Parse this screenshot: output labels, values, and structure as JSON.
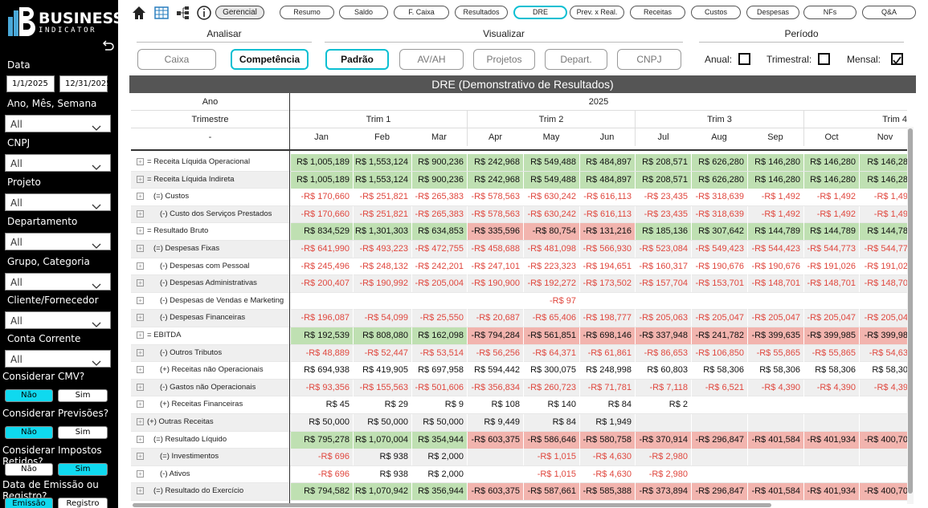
{
  "brand": {
    "line1": "BUSINESS",
    "line2": "INDICATOR"
  },
  "sidebar": {
    "date_label": "Data",
    "date_from": "1/1/2025",
    "date_to": "12/31/2025",
    "filters": [
      {
        "label": "Ano, Mês, Semana",
        "value": "All"
      },
      {
        "label": "CNPJ",
        "value": "All"
      },
      {
        "label": "Projeto",
        "value": "All"
      },
      {
        "label": "Departamento",
        "value": "All"
      },
      {
        "label": "Grupo, Categoria",
        "value": "All"
      },
      {
        "label": "Cliente/Fornecedor",
        "value": "All"
      },
      {
        "label": "Conta Corrente",
        "value": "All"
      }
    ],
    "toggles": [
      {
        "label": "Considerar CMV?",
        "a": "Não",
        "b": "Sim",
        "active": "a"
      },
      {
        "label": "Considerar Previsões?",
        "a": "Não",
        "b": "Sim",
        "active": "a"
      },
      {
        "label": "Considerar Impostos Retidos?",
        "a": "Não",
        "b": "Sim",
        "active": "b"
      },
      {
        "label": "Data de Emissão ou Registro?",
        "a": "Emissão",
        "b": "Registro",
        "active": "a"
      }
    ]
  },
  "topnav": {
    "gerencial": "Gerencial",
    "tabs": [
      "Resumo",
      "Saldo",
      "F. Caixa",
      "Resultados",
      "DRE",
      "Prev. x Real.",
      "Receitas",
      "Custos",
      "Despesas",
      "NFs",
      "Q&A"
    ],
    "selected": "DRE"
  },
  "sections": {
    "analisar": "Analisar",
    "visualizar": "Visualizar",
    "periodo": "Período"
  },
  "analisar_buttons": [
    "Caixa",
    "Competência"
  ],
  "visualizar_buttons": [
    "Padrão",
    "AV/AH",
    "Projetos",
    "Depart.",
    "CNPJ"
  ],
  "periodo": [
    {
      "label": "Anual:",
      "checked": false
    },
    {
      "label": "Trimestral:",
      "checked": false
    },
    {
      "label": "Mensal:",
      "checked": true
    }
  ],
  "report_title": "DRE (Demonstrativo de Resultados)",
  "table": {
    "hdr_ano": "Ano",
    "hdr_trimestre": "Trimestre",
    "hdr_dash": "-",
    "year": "2025",
    "quarters": [
      "Trim 1",
      "Trim 2",
      "Trim 3",
      "Trim 4"
    ],
    "months": [
      "Jan",
      "Feb",
      "Mar",
      "Apr",
      "May",
      "Jun",
      "Jul",
      "Aug",
      "Sep",
      "Oct",
      "Nov"
    ],
    "rows": [
      {
        "label": "= Receita Líquida Operacional",
        "indent": 0,
        "hl": true,
        "vals": [
          "R$ 1,005,189",
          "R$ 1,553,124",
          "R$ 900,236",
          "R$ 242,968",
          "R$ 549,488",
          "R$ 484,897",
          "R$ 208,571",
          "R$ 626,280",
          "R$ 146,280",
          "R$ 146,280",
          "R$ 146,28"
        ]
      },
      {
        "label": "= Receita Líquida Indireta",
        "indent": 0,
        "hl": true,
        "vals": [
          "R$ 1,005,189",
          "R$ 1,553,124",
          "R$ 900,236",
          "R$ 242,968",
          "R$ 549,488",
          "R$ 484,897",
          "R$ 208,571",
          "R$ 626,280",
          "R$ 146,280",
          "R$ 146,280",
          "R$ 146,28"
        ]
      },
      {
        "label": "(=) Custos",
        "indent": 1,
        "hl": false,
        "vals": [
          "-R$ 170,660",
          "-R$ 251,821",
          "-R$ 265,383",
          "-R$ 578,563",
          "-R$ 630,242",
          "-R$ 616,113",
          "-R$ 23,435",
          "-R$ 318,639",
          "-R$ 1,492",
          "-R$ 1,492",
          "-R$ 1,49"
        ]
      },
      {
        "label": "(-) Custo dos Serviços Prestados",
        "indent": 2,
        "hl": false,
        "vals": [
          "-R$ 170,660",
          "-R$ 251,821",
          "-R$ 265,383",
          "-R$ 578,563",
          "-R$ 630,242",
          "-R$ 616,113",
          "-R$ 23,435",
          "-R$ 318,639",
          "-R$ 1,492",
          "-R$ 1,492",
          "-R$ 1,49"
        ]
      },
      {
        "label": "= Resultado Bruto",
        "indent": 0,
        "hl": true,
        "vals": [
          "R$ 834,529",
          "R$ 1,301,303",
          "R$ 634,853",
          "-R$ 335,596",
          "-R$ 80,754",
          "-R$ 131,216",
          "R$ 185,136",
          "R$ 307,642",
          "R$ 144,789",
          "R$ 144,789",
          "R$ 144,78"
        ]
      },
      {
        "label": "(=) Despesas Fixas",
        "indent": 1,
        "hl": false,
        "vals": [
          "-R$ 641,990",
          "-R$ 493,223",
          "-R$ 472,755",
          "-R$ 458,688",
          "-R$ 481,098",
          "-R$ 566,930",
          "-R$ 523,084",
          "-R$ 549,423",
          "-R$ 544,423",
          "-R$ 544,773",
          "-R$ 544,77"
        ]
      },
      {
        "label": "(-) Despesas com Pessoal",
        "indent": 2,
        "hl": false,
        "vals": [
          "-R$ 245,496",
          "-R$ 248,132",
          "-R$ 242,201",
          "-R$ 247,101",
          "-R$ 223,323",
          "-R$ 194,651",
          "-R$ 160,317",
          "-R$ 190,676",
          "-R$ 190,676",
          "-R$ 191,026",
          "-R$ 191,02"
        ]
      },
      {
        "label": "(-) Despesas Administrativas",
        "indent": 2,
        "hl": false,
        "vals": [
          "-R$ 200,407",
          "-R$ 190,992",
          "-R$ 205,004",
          "-R$ 190,900",
          "-R$ 192,272",
          "-R$ 173,502",
          "-R$ 157,704",
          "-R$ 153,701",
          "-R$ 148,701",
          "-R$ 148,701",
          "-R$ 148,70"
        ]
      },
      {
        "label": "(-) Despesas de Vendas e Marketing",
        "indent": 2,
        "hl": false,
        "vals": [
          "",
          "",
          "",
          "",
          "-R$ 97",
          "",
          "",
          "",
          "",
          "",
          ""
        ]
      },
      {
        "label": "(-) Despesas Financeiras",
        "indent": 2,
        "hl": false,
        "vals": [
          "-R$ 196,087",
          "-R$ 54,099",
          "-R$ 25,550",
          "-R$ 20,687",
          "-R$ 65,406",
          "-R$ 198,777",
          "-R$ 205,063",
          "-R$ 205,047",
          "-R$ 205,047",
          "-R$ 205,047",
          "-R$ 205,04"
        ]
      },
      {
        "label": "= EBITDA",
        "indent": 0,
        "hl": true,
        "vals": [
          "R$ 192,539",
          "R$ 808,080",
          "R$ 162,098",
          "-R$ 794,284",
          "-R$ 561,851",
          "-R$ 698,146",
          "-R$ 337,948",
          "-R$ 241,782",
          "-R$ 399,635",
          "-R$ 399,985",
          "-R$ 399,98"
        ]
      },
      {
        "label": "(-) Outros Tributos",
        "indent": 2,
        "hl": false,
        "vals": [
          "-R$ 48,889",
          "-R$ 52,447",
          "-R$ 53,514",
          "-R$ 56,256",
          "-R$ 64,371",
          "-R$ 61,861",
          "-R$ 86,653",
          "-R$ 106,850",
          "-R$ 55,865",
          "-R$ 55,865",
          "-R$ 54,63"
        ]
      },
      {
        "label": "(+) Receitas não Operacionais",
        "indent": 2,
        "hl": false,
        "vals": [
          "R$ 694,938",
          "R$ 419,905",
          "R$ 697,958",
          "R$ 594,442",
          "R$ 300,075",
          "R$ 248,998",
          "R$ 60,803",
          "R$ 58,306",
          "R$ 58,306",
          "R$ 58,306",
          "R$ 58,30"
        ]
      },
      {
        "label": "(-) Gastos não Operacionais",
        "indent": 2,
        "hl": false,
        "vals": [
          "-R$ 93,356",
          "-R$ 155,563",
          "-R$ 501,606",
          "-R$ 356,834",
          "-R$ 260,723",
          "-R$ 71,781",
          "-R$ 7,118",
          "-R$ 6,521",
          "-R$ 4,390",
          "-R$ 4,390",
          "-R$ 4,39"
        ]
      },
      {
        "label": "(+) Receitas Financeiras",
        "indent": 2,
        "hl": false,
        "vals": [
          "R$ 45",
          "R$ 29",
          "R$ 9",
          "R$ 108",
          "R$ 140",
          "R$ 84",
          "R$ 2",
          "",
          "",
          "",
          ""
        ]
      },
      {
        "label": "(+) Outras Receitas",
        "indent": 0,
        "hl": false,
        "vals": [
          "R$ 50,000",
          "R$ 50,000",
          "R$ 50,000",
          "R$ 9,449",
          "R$ 84",
          "R$ 1,949",
          "",
          "",
          "",
          "",
          ""
        ]
      },
      {
        "label": "(=) Resultado Líquido",
        "indent": 1,
        "hl": true,
        "vals": [
          "R$ 795,278",
          "R$ 1,070,004",
          "R$ 354,944",
          "-R$ 603,375",
          "-R$ 586,646",
          "-R$ 580,758",
          "-R$ 370,914",
          "-R$ 296,847",
          "-R$ 401,584",
          "-R$ 401,934",
          "-R$ 400,70"
        ]
      },
      {
        "label": "(=) Investimentos",
        "indent": 2,
        "hl": false,
        "vals": [
          "-R$ 696",
          "R$ 938",
          "R$ 2,000",
          "",
          "-R$ 1,015",
          "-R$ 4,630",
          "-R$ 2,980",
          "",
          "",
          "",
          ""
        ]
      },
      {
        "label": "(-) Ativos",
        "indent": 2,
        "hl": false,
        "vals": [
          "-R$ 696",
          "R$ 938",
          "R$ 2,000",
          "",
          "-R$ 1,015",
          "-R$ 4,630",
          "-R$ 2,980",
          "",
          "",
          "",
          ""
        ]
      },
      {
        "label": "(=) Resultado do Exercício",
        "indent": 1,
        "hl": true,
        "vals": [
          "R$ 794,582",
          "R$ 1,070,942",
          "R$ 356,944",
          "-R$ 603,375",
          "-R$ 587,661",
          "-R$ 585,388",
          "-R$ 373,894",
          "-R$ 296,847",
          "-R$ 401,584",
          "-R$ 401,934",
          "-R$ 400,70"
        ]
      }
    ]
  },
  "colors": {
    "accent": "#0bbfd2",
    "positive_bg": "#bfe0b2",
    "negative_bg": "#f2b4ae",
    "negative_text": "#e0473e",
    "header_bg": "#555555"
  }
}
